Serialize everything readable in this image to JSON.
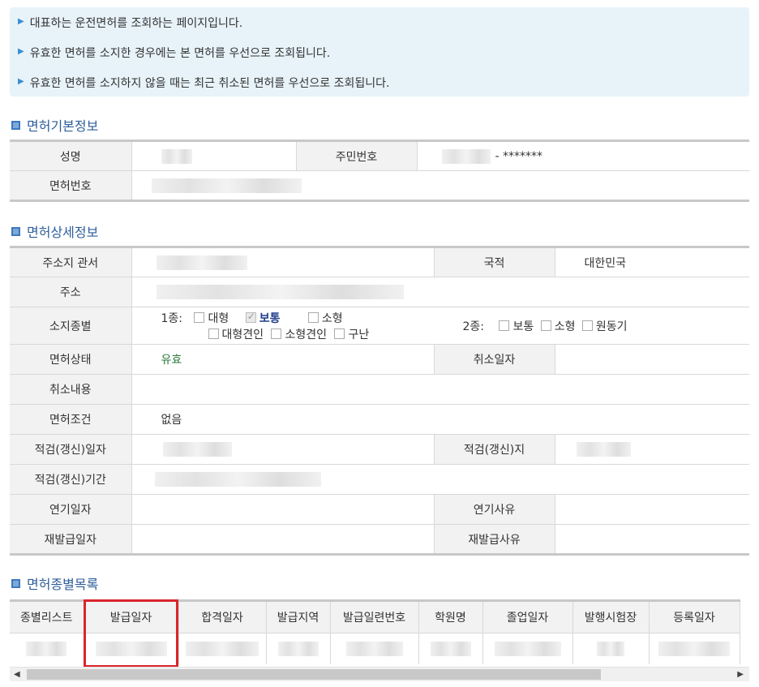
{
  "notice": [
    "대표하는 운전면허를 조회하는 페이지입니다.",
    "유효한 면허를 소지한 경우에는 본 면허를 우선으로 조회됩니다.",
    "유효한 면허를 소지하지 않을 때는 최근 취소된 면허를 우선으로 조회됩니다."
  ],
  "basic": {
    "title": "면허기본정보",
    "name_label": "성명",
    "rrn_label": "주민번호",
    "rrn_mask": "- *******",
    "license_no_label": "면허번호"
  },
  "detail": {
    "title": "면허상세정보",
    "jurisdiction_label": "주소지 관서",
    "nationality_label": "국적",
    "nationality": "대한민국",
    "address_label": "주소",
    "type_label": "소지종별",
    "class1_label": "1종:",
    "class1_opts": [
      "대형",
      "보통",
      "소형",
      "대형견인",
      "소형견인",
      "구난"
    ],
    "class2_label": "2종:",
    "class2_opts": [
      "보통",
      "소형",
      "원동기"
    ],
    "status_label": "면허상태",
    "status": "유효",
    "cancel_date_label": "취소일자",
    "cancel_reason_label": "취소내용",
    "condition_label": "면허조건",
    "condition": "없음",
    "renew_date_label": "적검(갱신)일자",
    "renew_place_label": "적검(갱신)지",
    "renew_period_label": "적검(갱신)기간",
    "defer_date_label": "연기일자",
    "defer_reason_label": "연기사유",
    "reissue_date_label": "재발급일자",
    "reissue_reason_label": "재발급사유"
  },
  "list": {
    "title": "면허종별목록",
    "columns": [
      "종별리스트",
      "발급일자",
      "합격일자",
      "발급지역",
      "발급일련번호",
      "학원명",
      "졸업일자",
      "발행시험장",
      "등록일자"
    ]
  }
}
